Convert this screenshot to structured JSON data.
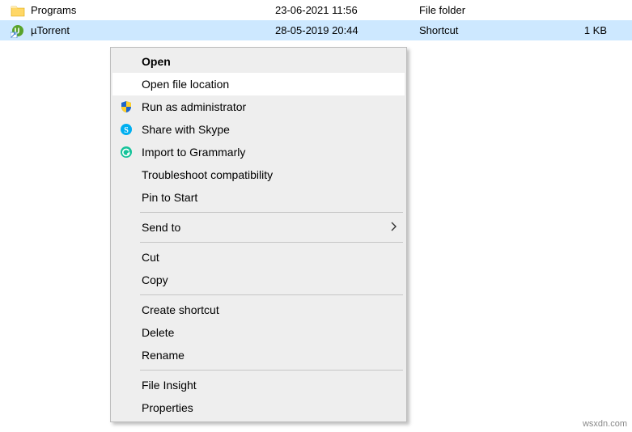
{
  "files": [
    {
      "name": "Programs",
      "date": "23-06-2021 11:56",
      "type": "File folder",
      "size": ""
    },
    {
      "name": "µTorrent",
      "date": "28-05-2019 20:44",
      "type": "Shortcut",
      "size": "1 KB"
    }
  ],
  "context_menu": {
    "open": "Open",
    "open_file_location": "Open file location",
    "run_as_admin": "Run as administrator",
    "share_skype": "Share with Skype",
    "import_grammarly": "Import to Grammarly",
    "troubleshoot": "Troubleshoot compatibility",
    "pin_start": "Pin to Start",
    "send_to": "Send to",
    "cut": "Cut",
    "copy": "Copy",
    "create_shortcut": "Create shortcut",
    "delete": "Delete",
    "rename": "Rename",
    "file_insight": "File Insight",
    "properties": "Properties"
  },
  "watermark": "wsxdn.com"
}
